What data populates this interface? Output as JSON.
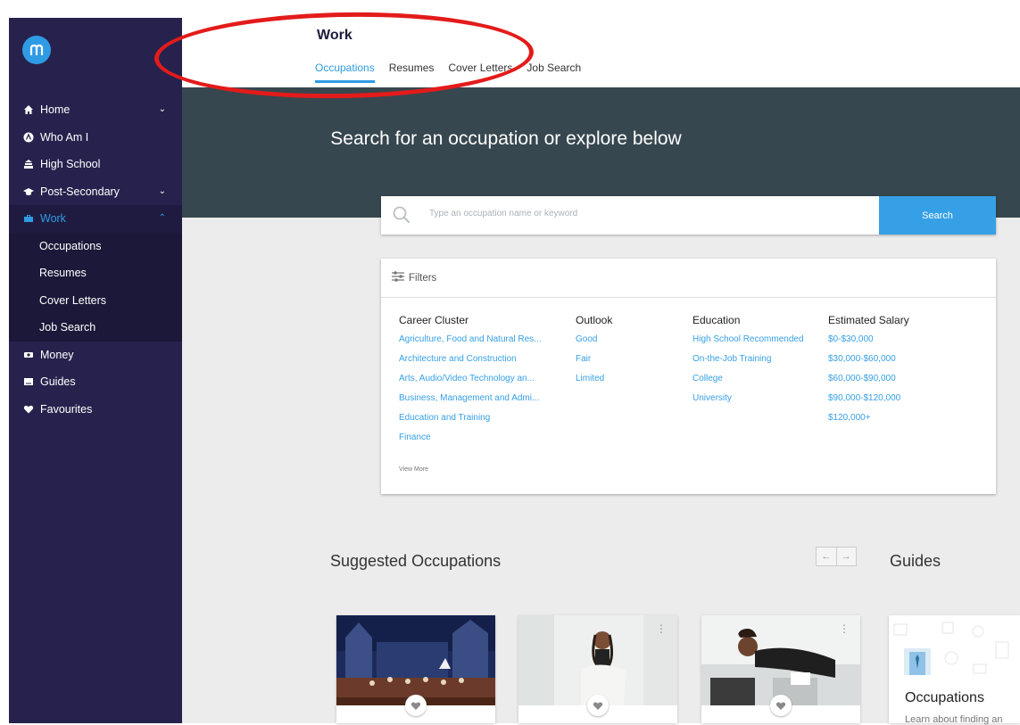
{
  "sidebar": {
    "logo_letter": "m",
    "items": [
      {
        "label": "Home",
        "icon": "home-icon",
        "chevron": "chevron-down"
      },
      {
        "label": "Who Am I",
        "icon": "person-circle-icon"
      },
      {
        "label": "High School",
        "icon": "school-icon"
      },
      {
        "label": "Post-Secondary",
        "icon": "graduation-cap-icon",
        "chevron": "chevron-down"
      },
      {
        "label": "Work",
        "icon": "briefcase-icon",
        "chevron": "chevron-up",
        "active": true
      },
      {
        "label": "Money",
        "icon": "money-icon"
      },
      {
        "label": "Guides",
        "icon": "book-icon"
      },
      {
        "label": "Favourites",
        "icon": "heart-icon"
      }
    ],
    "work_subitems": [
      "Occupations",
      "Resumes",
      "Cover Letters",
      "Job Search"
    ]
  },
  "header": {
    "title": "Work",
    "tabs": [
      "Occupations",
      "Resumes",
      "Cover Letters",
      "Job Search"
    ],
    "active_tab": "Occupations"
  },
  "hero": {
    "title": "Search for an occupation or explore below"
  },
  "search": {
    "placeholder": "Type an occupation name or keyword",
    "button_label": "Search"
  },
  "filters": {
    "label": "Filters",
    "columns": [
      {
        "heading": "Career Cluster",
        "items": [
          "Agriculture, Food and Natural Res...",
          "Architecture and Construction",
          "Arts, Audio/Video Technology an...",
          "Business, Management and Admi...",
          "Education and Training",
          "Finance"
        ]
      },
      {
        "heading": "Outlook",
        "items": [
          "Good",
          "Fair",
          "Limited"
        ]
      },
      {
        "heading": "Education",
        "items": [
          "High School Recommended",
          "On-the-Job Training",
          "College",
          "University"
        ]
      },
      {
        "heading": "Estimated Salary",
        "items": [
          "$0-$30,000",
          "$30,000-$60,000",
          "$60,000-$90,000",
          "$90,000-$120,000",
          "$120,000+"
        ]
      }
    ],
    "view_more": "View More"
  },
  "suggested": {
    "title": "Suggested Occupations",
    "arrows": [
      "←",
      "→"
    ]
  },
  "guides": {
    "title": "Guides",
    "card_title": "Occupations",
    "card_desc": "Learn about finding an"
  },
  "colors": {
    "sidebar_bg": "#26224d",
    "accent": "#2f9be5",
    "hero_bg": "#37474f",
    "annotation": "#e31b1b"
  }
}
